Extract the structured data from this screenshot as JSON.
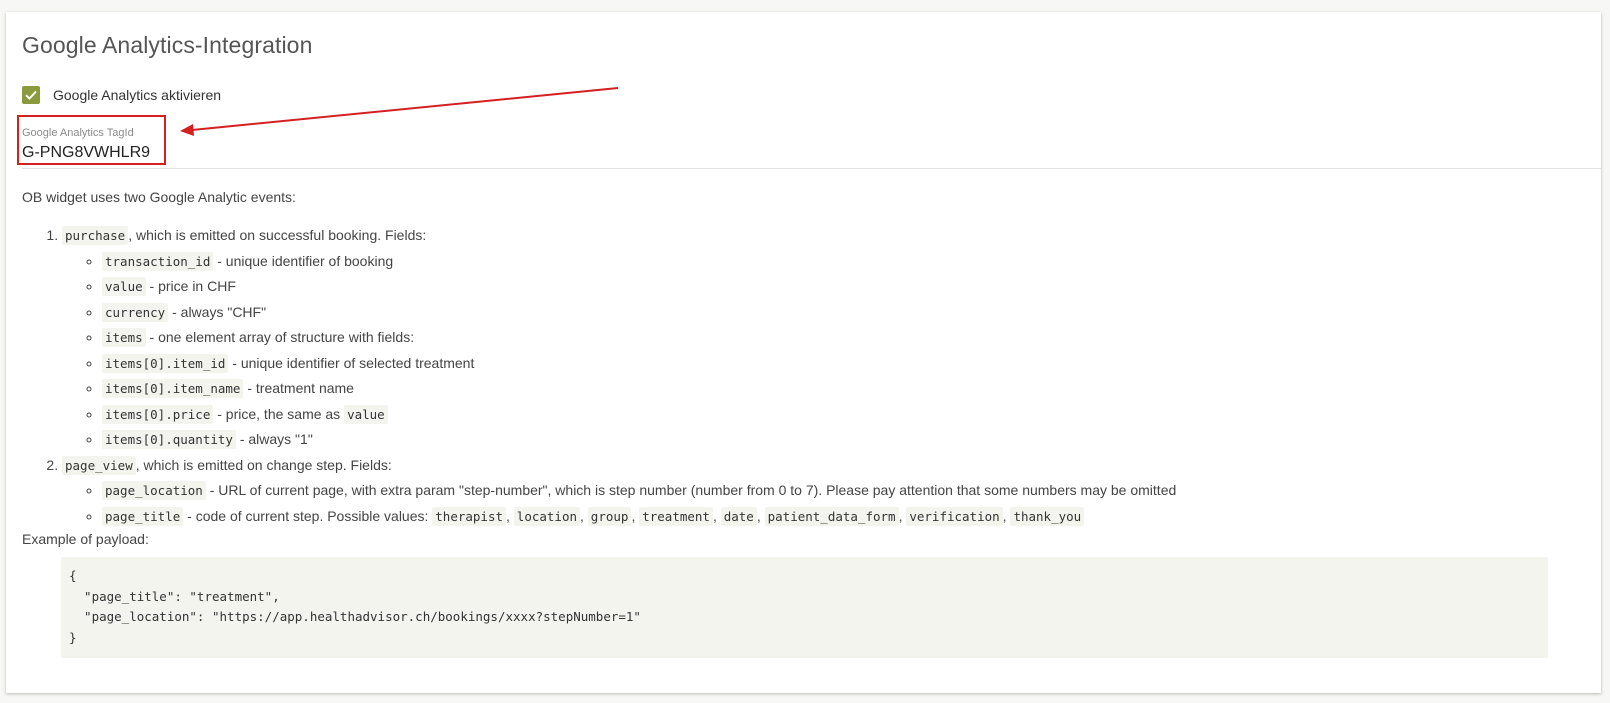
{
  "section": {
    "title": "Google Analytics-Integration"
  },
  "enable": {
    "checked": true,
    "label": "Google Analytics aktivieren"
  },
  "tag_field": {
    "label": "Google Analytics TagId",
    "value": "G-PNG8VWHLR9"
  },
  "doc": {
    "intro": "OB widget uses two Google Analytic events:",
    "events": [
      {
        "name": "purchase",
        "description": ", which is emitted on successful booking. Fields:",
        "fields": [
          {
            "code": "transaction_id",
            "desc": " - unique identifier of booking"
          },
          {
            "code": "value",
            "desc": " - price in CHF"
          },
          {
            "code": "currency",
            "desc": " - always \"CHF\""
          },
          {
            "code": "items",
            "desc": " - one element array of structure with fields:"
          },
          {
            "code": "items[0].item_id",
            "desc": " - unique identifier of selected treatment"
          },
          {
            "code": "items[0].item_name",
            "desc": " - treatment name"
          },
          {
            "code": "items[0].price",
            "desc": " - price, the same as ",
            "code2": "value"
          },
          {
            "code": "items[0].quantity",
            "desc": " - always \"1\""
          }
        ]
      },
      {
        "name": "page_view",
        "description": ", which is emitted on change step. Fields:",
        "fields": [
          {
            "code": "page_location",
            "desc": " - URL of current page, with extra param \"step-number\", which is step number (number from 0 to 7). Please pay attention that some numbers may be omitted"
          },
          {
            "code": "page_title",
            "desc": " - code of current step. Possible values: "
          }
        ],
        "page_title_values": [
          "therapist",
          "location",
          "group",
          "treatment",
          "date",
          "patient_data_form",
          "verification",
          "thank_you"
        ]
      }
    ],
    "payload_label": "Example of payload:",
    "payload_lines": [
      "{",
      "  \"page_title\": \"treatment\",",
      "  \"page_location\": \"https://app.healthadvisor.ch/bookings/xxxx?stepNumber=1\"",
      "}"
    ]
  },
  "colors": {
    "checkbox": "#8a9a3c",
    "annotation": "#d42020",
    "code_bg": "#f4f4ef"
  },
  "icons": {
    "checkbox": "check-icon"
  }
}
